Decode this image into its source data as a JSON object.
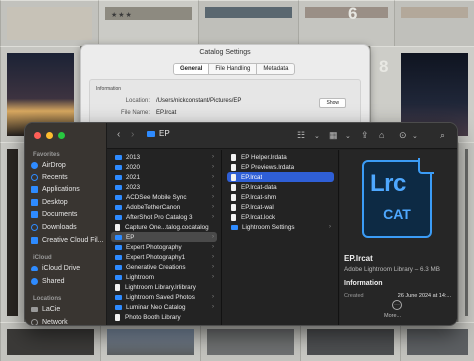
{
  "lightroom": {
    "cell_numbers": [
      "6",
      "8"
    ],
    "stars": "★★★"
  },
  "catalog_dialog": {
    "title": "Catalog Settings",
    "tabs": [
      "General",
      "File Handling",
      "Metadata"
    ],
    "active_tab": "General",
    "section": "Information",
    "location_label": "Location:",
    "location_value": "/Users/nickconstant/Pictures/EP",
    "file_name_label": "File Name:",
    "file_name_value": "EP.lrcat",
    "show_button": "Show"
  },
  "finder": {
    "path_title": "EP",
    "sidebar": {
      "favorites_header": "Favorites",
      "favorites": [
        {
          "label": "AirDrop",
          "icon": "airdrop-icon"
        },
        {
          "label": "Recents",
          "icon": "clock-icon"
        },
        {
          "label": "Applications",
          "icon": "applications-icon"
        },
        {
          "label": "Desktop",
          "icon": "folder-icon"
        },
        {
          "label": "Documents",
          "icon": "folder-icon"
        },
        {
          "label": "Downloads",
          "icon": "downloads-icon"
        },
        {
          "label": "Creative Cloud Fil...",
          "icon": "folder-icon"
        }
      ],
      "icloud_header": "iCloud",
      "icloud": [
        {
          "label": "iCloud Drive",
          "icon": "cloud-icon"
        },
        {
          "label": "Shared",
          "icon": "shared-icon"
        }
      ],
      "locations_header": "Locations",
      "locations": [
        {
          "label": "LaCie",
          "icon": "disk-icon"
        },
        {
          "label": "Network",
          "icon": "globe-icon"
        }
      ]
    },
    "column1": [
      {
        "label": "2013",
        "type": "folder"
      },
      {
        "label": "2020",
        "type": "folder"
      },
      {
        "label": "2021",
        "type": "folder"
      },
      {
        "label": "2023",
        "type": "folder"
      },
      {
        "label": "ACDSee Mobile Sync",
        "type": "folder"
      },
      {
        "label": "AdobeTetherCanon",
        "type": "folder"
      },
      {
        "label": "AfterShot Pro Catalog 3",
        "type": "folder"
      },
      {
        "label": "Capture One...talog.cocatalog",
        "type": "file"
      },
      {
        "label": "EP",
        "type": "folder",
        "selected": true
      },
      {
        "label": "Expert Photography",
        "type": "folder"
      },
      {
        "label": "Expert Photography1",
        "type": "folder"
      },
      {
        "label": "Generative Creations",
        "type": "folder"
      },
      {
        "label": "Lightroom",
        "type": "folder"
      },
      {
        "label": "Lightroom Library.lrlibrary",
        "type": "file"
      },
      {
        "label": "Lightroom Saved Photos",
        "type": "folder"
      },
      {
        "label": "Luminar Neo Catalog",
        "type": "folder"
      },
      {
        "label": "Photo Booth Library",
        "type": "file"
      }
    ],
    "column2": [
      {
        "label": "EP Helper.lrdata",
        "type": "file"
      },
      {
        "label": "EP Previews.lrdata",
        "type": "file"
      },
      {
        "label": "EP.lrcat",
        "type": "file",
        "selected": true
      },
      {
        "label": "EP.lrcat-data",
        "type": "file"
      },
      {
        "label": "EP.lrcat-shm",
        "type": "file"
      },
      {
        "label": "EP.lrcat-wal",
        "type": "file"
      },
      {
        "label": "EP.lrcat.lock",
        "type": "file"
      },
      {
        "label": "Lightroom Settings",
        "type": "folder"
      }
    ],
    "preview": {
      "icon_text": "Lrc",
      "icon_sub": "CAT",
      "name": "EP.lrcat",
      "kind": "Adobe Lightroom Library – 6.3 MB",
      "info_header": "Information",
      "created_label": "Created",
      "created_value": "26 June 2024 at 14:...",
      "more": "More..."
    },
    "colors": {
      "accent": "#2e8bff",
      "selection": "#2f5fd6",
      "lrc_blue": "#4ea8ff"
    }
  }
}
